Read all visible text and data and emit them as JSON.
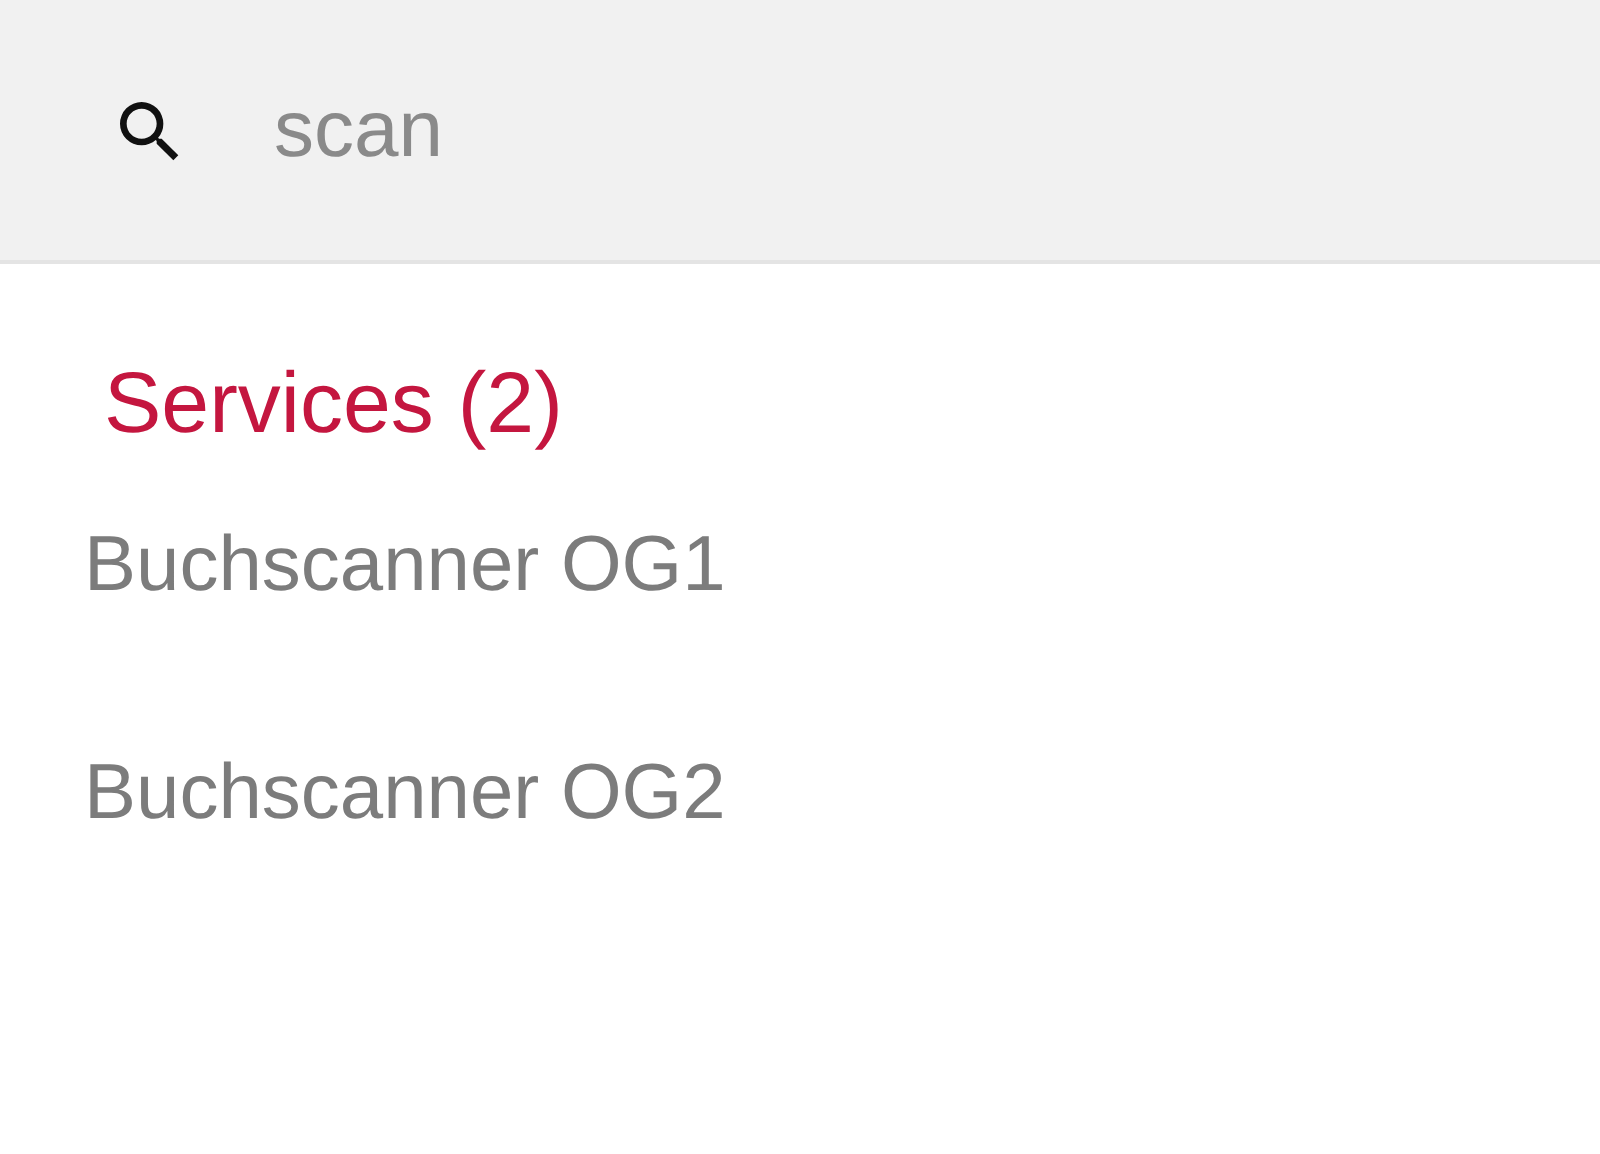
{
  "search": {
    "value": "scan"
  },
  "section": {
    "title": "Services (2)"
  },
  "results": [
    {
      "label": "Buchscanner OG1"
    },
    {
      "label": "Buchscanner OG2"
    }
  ]
}
